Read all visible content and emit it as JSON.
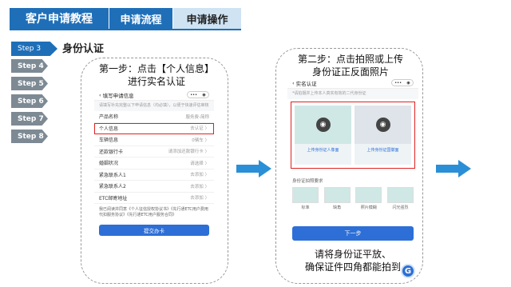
{
  "header": {
    "title": "客户申请教程",
    "tabs": [
      "申请流程",
      "申请操作"
    ]
  },
  "steps": [
    {
      "label": "Step 3",
      "title": "身份认证"
    },
    {
      "label": "Step 4"
    },
    {
      "label": "Step 5"
    },
    {
      "label": "Step 6"
    },
    {
      "label": "Step 7"
    },
    {
      "label": "Step 8"
    }
  ],
  "panel1": {
    "caption_line1": "第一步：点击【个人信息】",
    "caption_line2": "进行实名认证",
    "screen": {
      "title": "填写申请信息",
      "tip": "请填写补充完整以下申请信息（均必填），以便于快速评估审核",
      "rows": [
        {
          "label": "产品名称",
          "value": "服务费-简称"
        },
        {
          "label": "个人信息",
          "value": "去认证 〉"
        },
        {
          "label": "车辆信息",
          "value": "0辆车 〉"
        },
        {
          "label": "还款银行卡",
          "value": "请添加还款银行卡 〉"
        },
        {
          "label": "婚姻状况",
          "value": "请选择 〉"
        },
        {
          "label": "紧急联系人1",
          "value": "去添加 〉"
        },
        {
          "label": "紧急联系人2",
          "value": "去添加 〉"
        },
        {
          "label": "ETC邮寄地址",
          "value": "去添加 〉"
        }
      ],
      "agreement": "我已阅读并同意《个人征信授权协议书》《先行通ETC用户费用代扣服务协议》《先行通ETC用户服务合同》",
      "submit": "提交办卡"
    }
  },
  "panel2": {
    "caption_line1": "第二步：点击拍照或上传",
    "caption_line2": "身份证正反面照片",
    "screen": {
      "title": "实名认证",
      "tip": "*请拍摄并上传本人真实有效的二代身份证",
      "front_label": "上传身份证人像面",
      "back_label": "上传身份证国徽面",
      "req_title": "身份证拍照要求",
      "thumbs": [
        "标准",
        "缺角",
        "照片模糊",
        "闪光强烈"
      ],
      "next": "下一步"
    },
    "bottom_line1": "请将身份证平放、",
    "bottom_line2": "确保证件四角都能拍到"
  },
  "pill": {
    "dots": "•••",
    "target": "◉"
  },
  "colors": {
    "primary": "#1f6fb8",
    "button": "#2d6fd6",
    "highlight": "#e02020",
    "arrow": "#2a8fd6"
  },
  "icons": {
    "camera": "camera-icon",
    "arrow": "right-arrow-icon",
    "back": "chevron-left-icon",
    "logo": "G"
  }
}
